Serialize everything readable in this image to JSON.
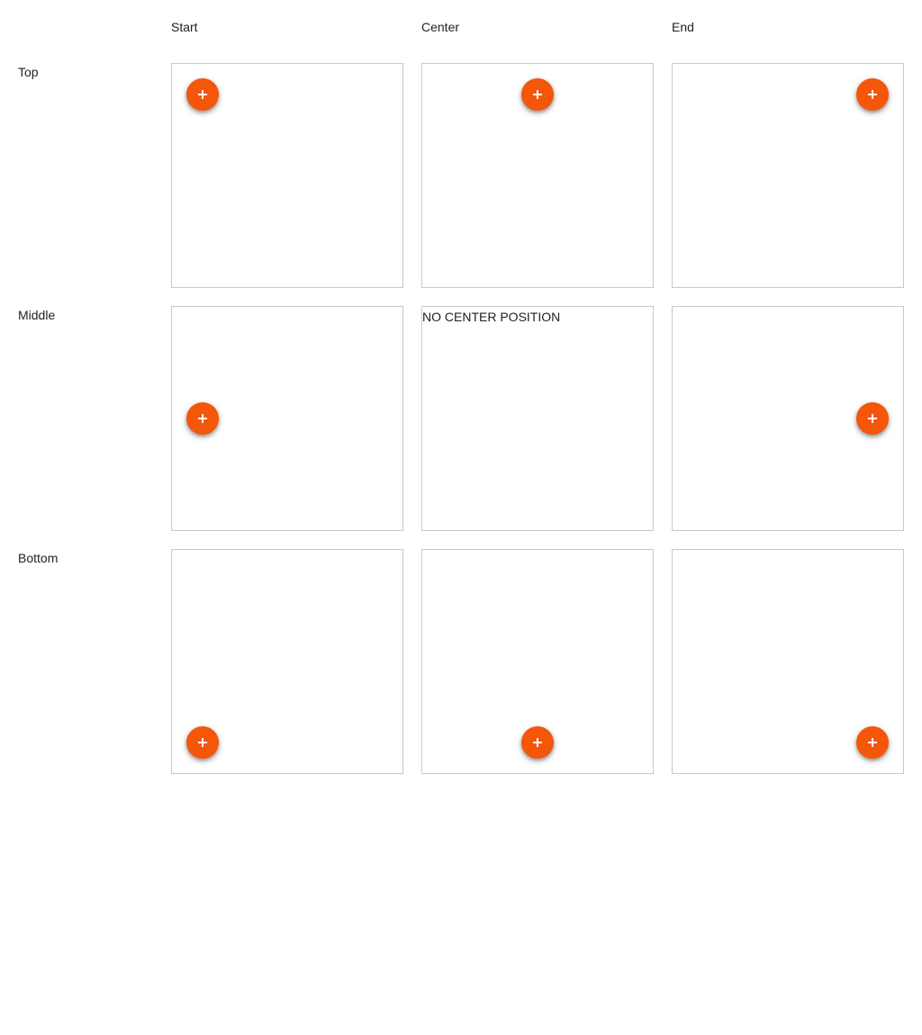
{
  "columns": [
    "Start",
    "Center",
    "End"
  ],
  "rows": [
    "Top",
    "Middle",
    "Bottom"
  ],
  "fab": {
    "icon": "plus-icon",
    "color": "#f4560a"
  },
  "cells": {
    "middle_center_note": "NO CENTER POSITION"
  }
}
